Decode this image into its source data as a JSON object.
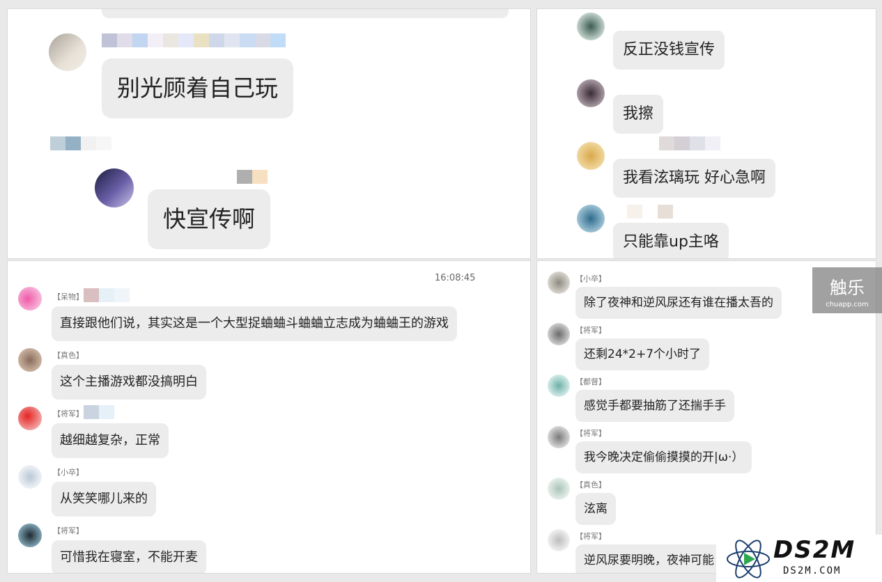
{
  "top_left": {
    "messages": [
      {
        "text": "别光顾着自己玩"
      },
      {
        "text": "快宣传啊"
      }
    ]
  },
  "bottom_left": {
    "timestamp": "16:08:45",
    "messages": [
      {
        "tag": "【呆物】",
        "text": "直接跟他们说，其实这是一个大型捉蛐蛐斗蛐蛐立志成为蛐蛐王的游戏"
      },
      {
        "tag": "【真色】",
        "text": "这个主播游戏都没搞明白"
      },
      {
        "tag": "【将军】",
        "text": "越细越复杂，正常"
      },
      {
        "tag": "【小卒】",
        "text": "从笑笑哪儿来的"
      },
      {
        "tag": "【将军】",
        "text": "可惜我在寝室，不能开麦"
      }
    ]
  },
  "top_right": {
    "messages": [
      {
        "text": "反正没钱宣传"
      },
      {
        "text": "我擦"
      },
      {
        "text": "我看泫璃玩 好心急啊"
      },
      {
        "text": "只能靠up主咯"
      }
    ]
  },
  "bottom_right": {
    "messages": [
      {
        "tag": "【小卒】",
        "text": "除了夜神和逆风尿还有谁在播太吾的"
      },
      {
        "tag": "【将军】",
        "text": "还剩24*2+7个小时了"
      },
      {
        "tag": "【都督】",
        "text": "感觉手都要抽筋了还揣手手"
      },
      {
        "tag": "【将军】",
        "text": "我今晚决定偷偷摸摸的开|ω·）"
      },
      {
        "tag": "【真色】",
        "text": "泫离"
      },
      {
        "tag": "【将军】",
        "text": "逆风尿要明晚，夜神可能"
      }
    ]
  },
  "watermark": {
    "cn": "触乐",
    "en": "chuapp.com"
  },
  "logo": {
    "big": "DS2M",
    "small": "DS2M.COM"
  },
  "colors": {
    "bubble": "#ececec",
    "panel": "#ffffff",
    "gap": "#e9e9e9"
  }
}
